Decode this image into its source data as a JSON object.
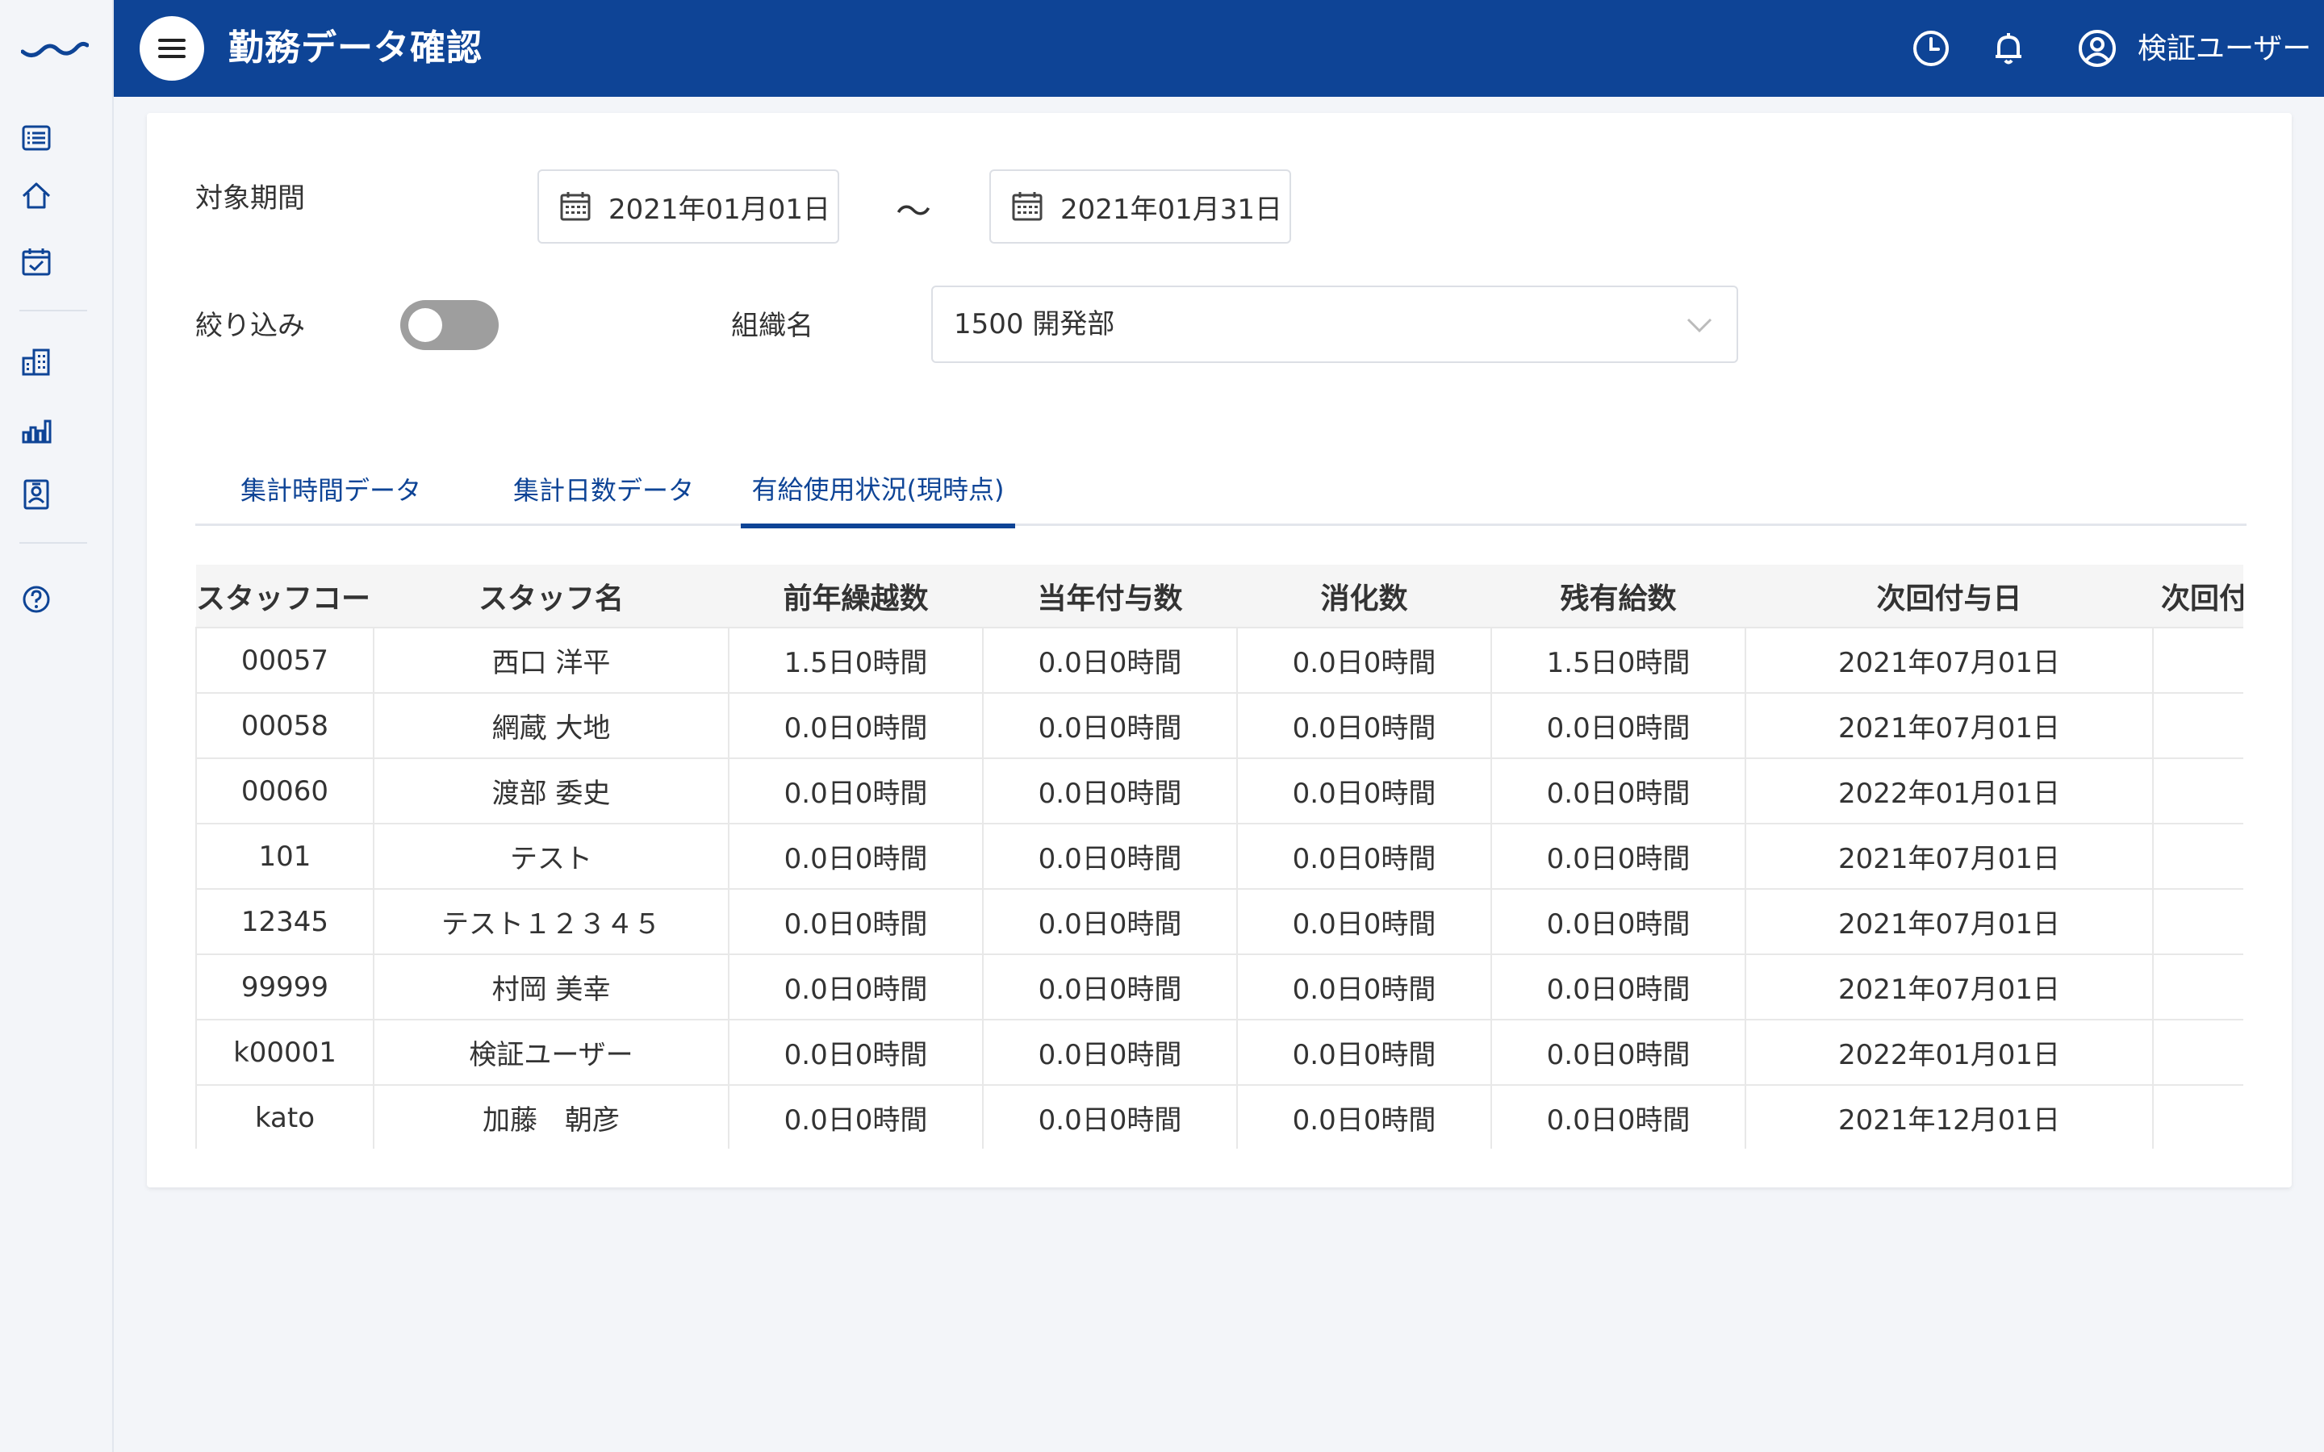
{
  "app": {
    "logo_icon": "wave-logo-icon",
    "accent_color": "#0e4496"
  },
  "sidebar": {
    "icons": [
      "list-icon",
      "home-icon",
      "calendar-check-icon",
      "building-icon",
      "bar-chart-icon",
      "id-badge-icon",
      "help-icon"
    ]
  },
  "header": {
    "title": "勤務データ確認",
    "user_name": "検証ユーザー",
    "icons": [
      "menu-icon",
      "clock-icon",
      "bell-icon",
      "user-circle-icon"
    ]
  },
  "filters": {
    "period_label": "対象期間",
    "start_date": "2021年01月01日",
    "separator": "〜",
    "end_date": "2021年01月31日",
    "narrow_label": "絞り込み",
    "narrow_toggle_on": false,
    "org_label": "組織名",
    "org_value": "1500 開発部"
  },
  "tabs": [
    {
      "label": "集計時間データ",
      "active": false
    },
    {
      "label": "集計日数データ",
      "active": false
    },
    {
      "label": "有給使用状況(現時点)",
      "active": true
    }
  ],
  "table": {
    "headers": [
      "スタッフコード",
      "スタッフ名",
      "前年繰越数",
      "当年付与数",
      "消化数",
      "残有給数",
      "次回付与日",
      "次回付"
    ],
    "rows": [
      [
        "00057",
        "西口 洋平",
        "1.5日0時間",
        "0.0日0時間",
        "0.0日0時間",
        "1.5日0時間",
        "2021年07月01日",
        ""
      ],
      [
        "00058",
        "網蔵 大地",
        "0.0日0時間",
        "0.0日0時間",
        "0.0日0時間",
        "0.0日0時間",
        "2021年07月01日",
        ""
      ],
      [
        "00060",
        "渡部 委史",
        "0.0日0時間",
        "0.0日0時間",
        "0.0日0時間",
        "0.0日0時間",
        "2022年01月01日",
        ""
      ],
      [
        "101",
        "テスト",
        "0.0日0時間",
        "0.0日0時間",
        "0.0日0時間",
        "0.0日0時間",
        "2021年07月01日",
        ""
      ],
      [
        "12345",
        "テスト１２３４５",
        "0.0日0時間",
        "0.0日0時間",
        "0.0日0時間",
        "0.0日0時間",
        "2021年07月01日",
        ""
      ],
      [
        "99999",
        "村岡 美幸",
        "0.0日0時間",
        "0.0日0時間",
        "0.0日0時間",
        "0.0日0時間",
        "2021年07月01日",
        ""
      ],
      [
        "k00001",
        "検証ユーザー",
        "0.0日0時間",
        "0.0日0時間",
        "0.0日0時間",
        "0.0日0時間",
        "2022年01月01日",
        ""
      ],
      [
        "kato",
        "加藤　朝彦",
        "0.0日0時間",
        "0.0日0時間",
        "0.0日0時間",
        "0.0日0時間",
        "2021年12月01日",
        ""
      ]
    ]
  }
}
